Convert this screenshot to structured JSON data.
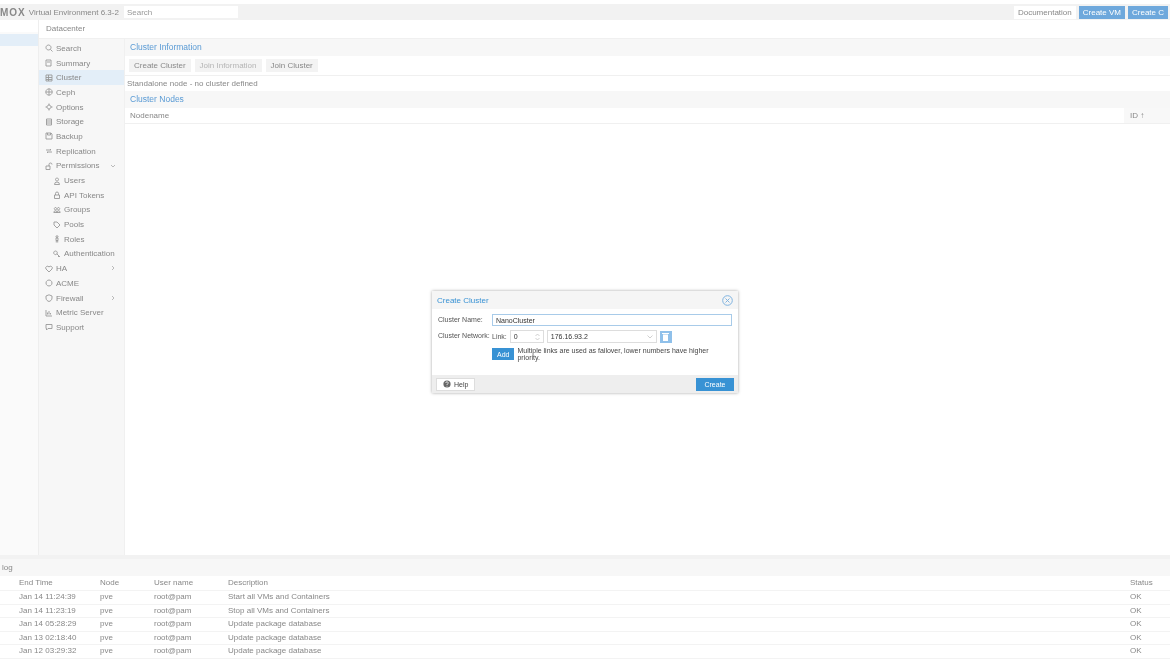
{
  "header": {
    "logo": "MOX",
    "version": "Virtual Environment 6.3-2",
    "search": {
      "placeholder": "Search"
    },
    "buttons": [
      {
        "label": "Documentation",
        "kind": "plain"
      },
      {
        "label": "Create VM",
        "kind": "primary"
      },
      {
        "label": "Create C",
        "kind": "primary"
      }
    ]
  },
  "tree": {
    "items": [
      {
        "selected": true
      }
    ]
  },
  "breadcrumb": "Datacenter",
  "nav": [
    {
      "label": "Search",
      "selected": false
    },
    {
      "label": "Summary",
      "selected": false
    },
    {
      "label": "Cluster",
      "selected": true
    },
    {
      "label": "Ceph",
      "selected": false
    },
    {
      "label": "Options",
      "selected": false
    },
    {
      "label": "Storage",
      "selected": false
    },
    {
      "label": "Backup",
      "selected": false
    },
    {
      "label": "Replication",
      "selected": false
    },
    {
      "label": "Permissions",
      "selected": false,
      "expanded": true,
      "children": [
        {
          "label": "Users",
          "selected": false
        },
        {
          "label": "API Tokens",
          "selected": false
        },
        {
          "label": "Groups",
          "selected": false
        },
        {
          "label": "Pools",
          "selected": false
        },
        {
          "label": "Roles",
          "selected": false
        },
        {
          "label": "Authentication",
          "selected": false
        }
      ]
    },
    {
      "label": "HA",
      "selected": false,
      "expanded": false
    },
    {
      "label": "ACME",
      "selected": false
    },
    {
      "label": "Firewall",
      "selected": false,
      "expanded": false
    },
    {
      "label": "Metric Server",
      "selected": false
    },
    {
      "label": "Support",
      "selected": false
    }
  ],
  "cluster_information": {
    "title": "Cluster Information",
    "buttons": [
      {
        "label": "Create Cluster",
        "disabled": false
      },
      {
        "label": "Join Information",
        "disabled": true
      },
      {
        "label": "Join Cluster",
        "disabled": false
      }
    ],
    "status": "Standalone node - no cluster defined"
  },
  "cluster_nodes": {
    "title": "Cluster Nodes",
    "columns": [
      "Nodename",
      "ID ↑"
    ]
  },
  "log": {
    "title": "log",
    "columns": [
      "End Time",
      "Node",
      "User name",
      "Description",
      "Status"
    ],
    "rows": [
      [
        "Jan 14 11:24:39",
        "pve",
        "root@pam",
        "Start all VMs and Containers",
        "OK"
      ],
      [
        "Jan 14 11:23:19",
        "pve",
        "root@pam",
        "Stop all VMs and Containers",
        "OK"
      ],
      [
        "Jan 14 05:28:29",
        "pve",
        "root@pam",
        "Update package database",
        "OK"
      ],
      [
        "Jan 13 02:18:40",
        "pve",
        "root@pam",
        "Update package database",
        "OK"
      ],
      [
        "Jan 12 03:29:32",
        "pve",
        "root@pam",
        "Update package database",
        "OK"
      ]
    ]
  },
  "dialog": {
    "title": "Create Cluster",
    "name_label": "Cluster Name:",
    "name_value": "NanoCluster",
    "network_label": "Cluster Network:",
    "link_label": "Link:",
    "link_value": "0",
    "address": "176.16.93.2",
    "add_button": "Add",
    "hint": "Multiple links are used as failover, lower numbers have higher priority.",
    "help_button": "Help",
    "create_button": "Create"
  }
}
